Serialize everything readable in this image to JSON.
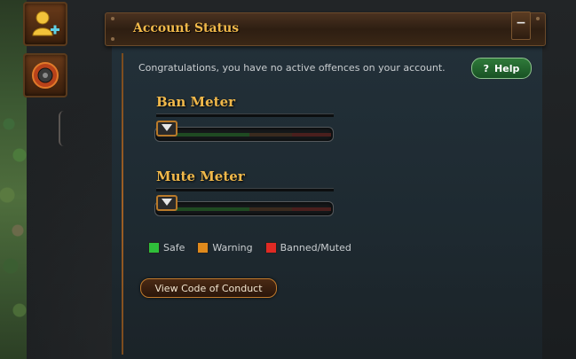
{
  "panel": {
    "title": "Account Status",
    "collapse_label": "−",
    "message": "Congratulations, you have no active offences on your account.",
    "help_label": "Help",
    "help_icon": "?"
  },
  "meters": {
    "ban": {
      "title": "Ban Meter",
      "level": 0
    },
    "mute": {
      "title": "Mute Meter",
      "level": 0
    }
  },
  "legend": [
    {
      "label": "Safe",
      "color": "#2fbf3a"
    },
    {
      "label": "Warning",
      "color": "#e08a1c"
    },
    {
      "label": "Banned/Muted",
      "color": "#e02a24"
    }
  ],
  "conduct_button": "View Code of Conduct",
  "colors": {
    "accent_gold": "#f0b84a",
    "help_green": "#2f7a3a",
    "panel_bg": "#23313a"
  },
  "side_buttons": [
    {
      "icon": "add-friend-icon"
    },
    {
      "icon": "emblem-icon"
    }
  ]
}
